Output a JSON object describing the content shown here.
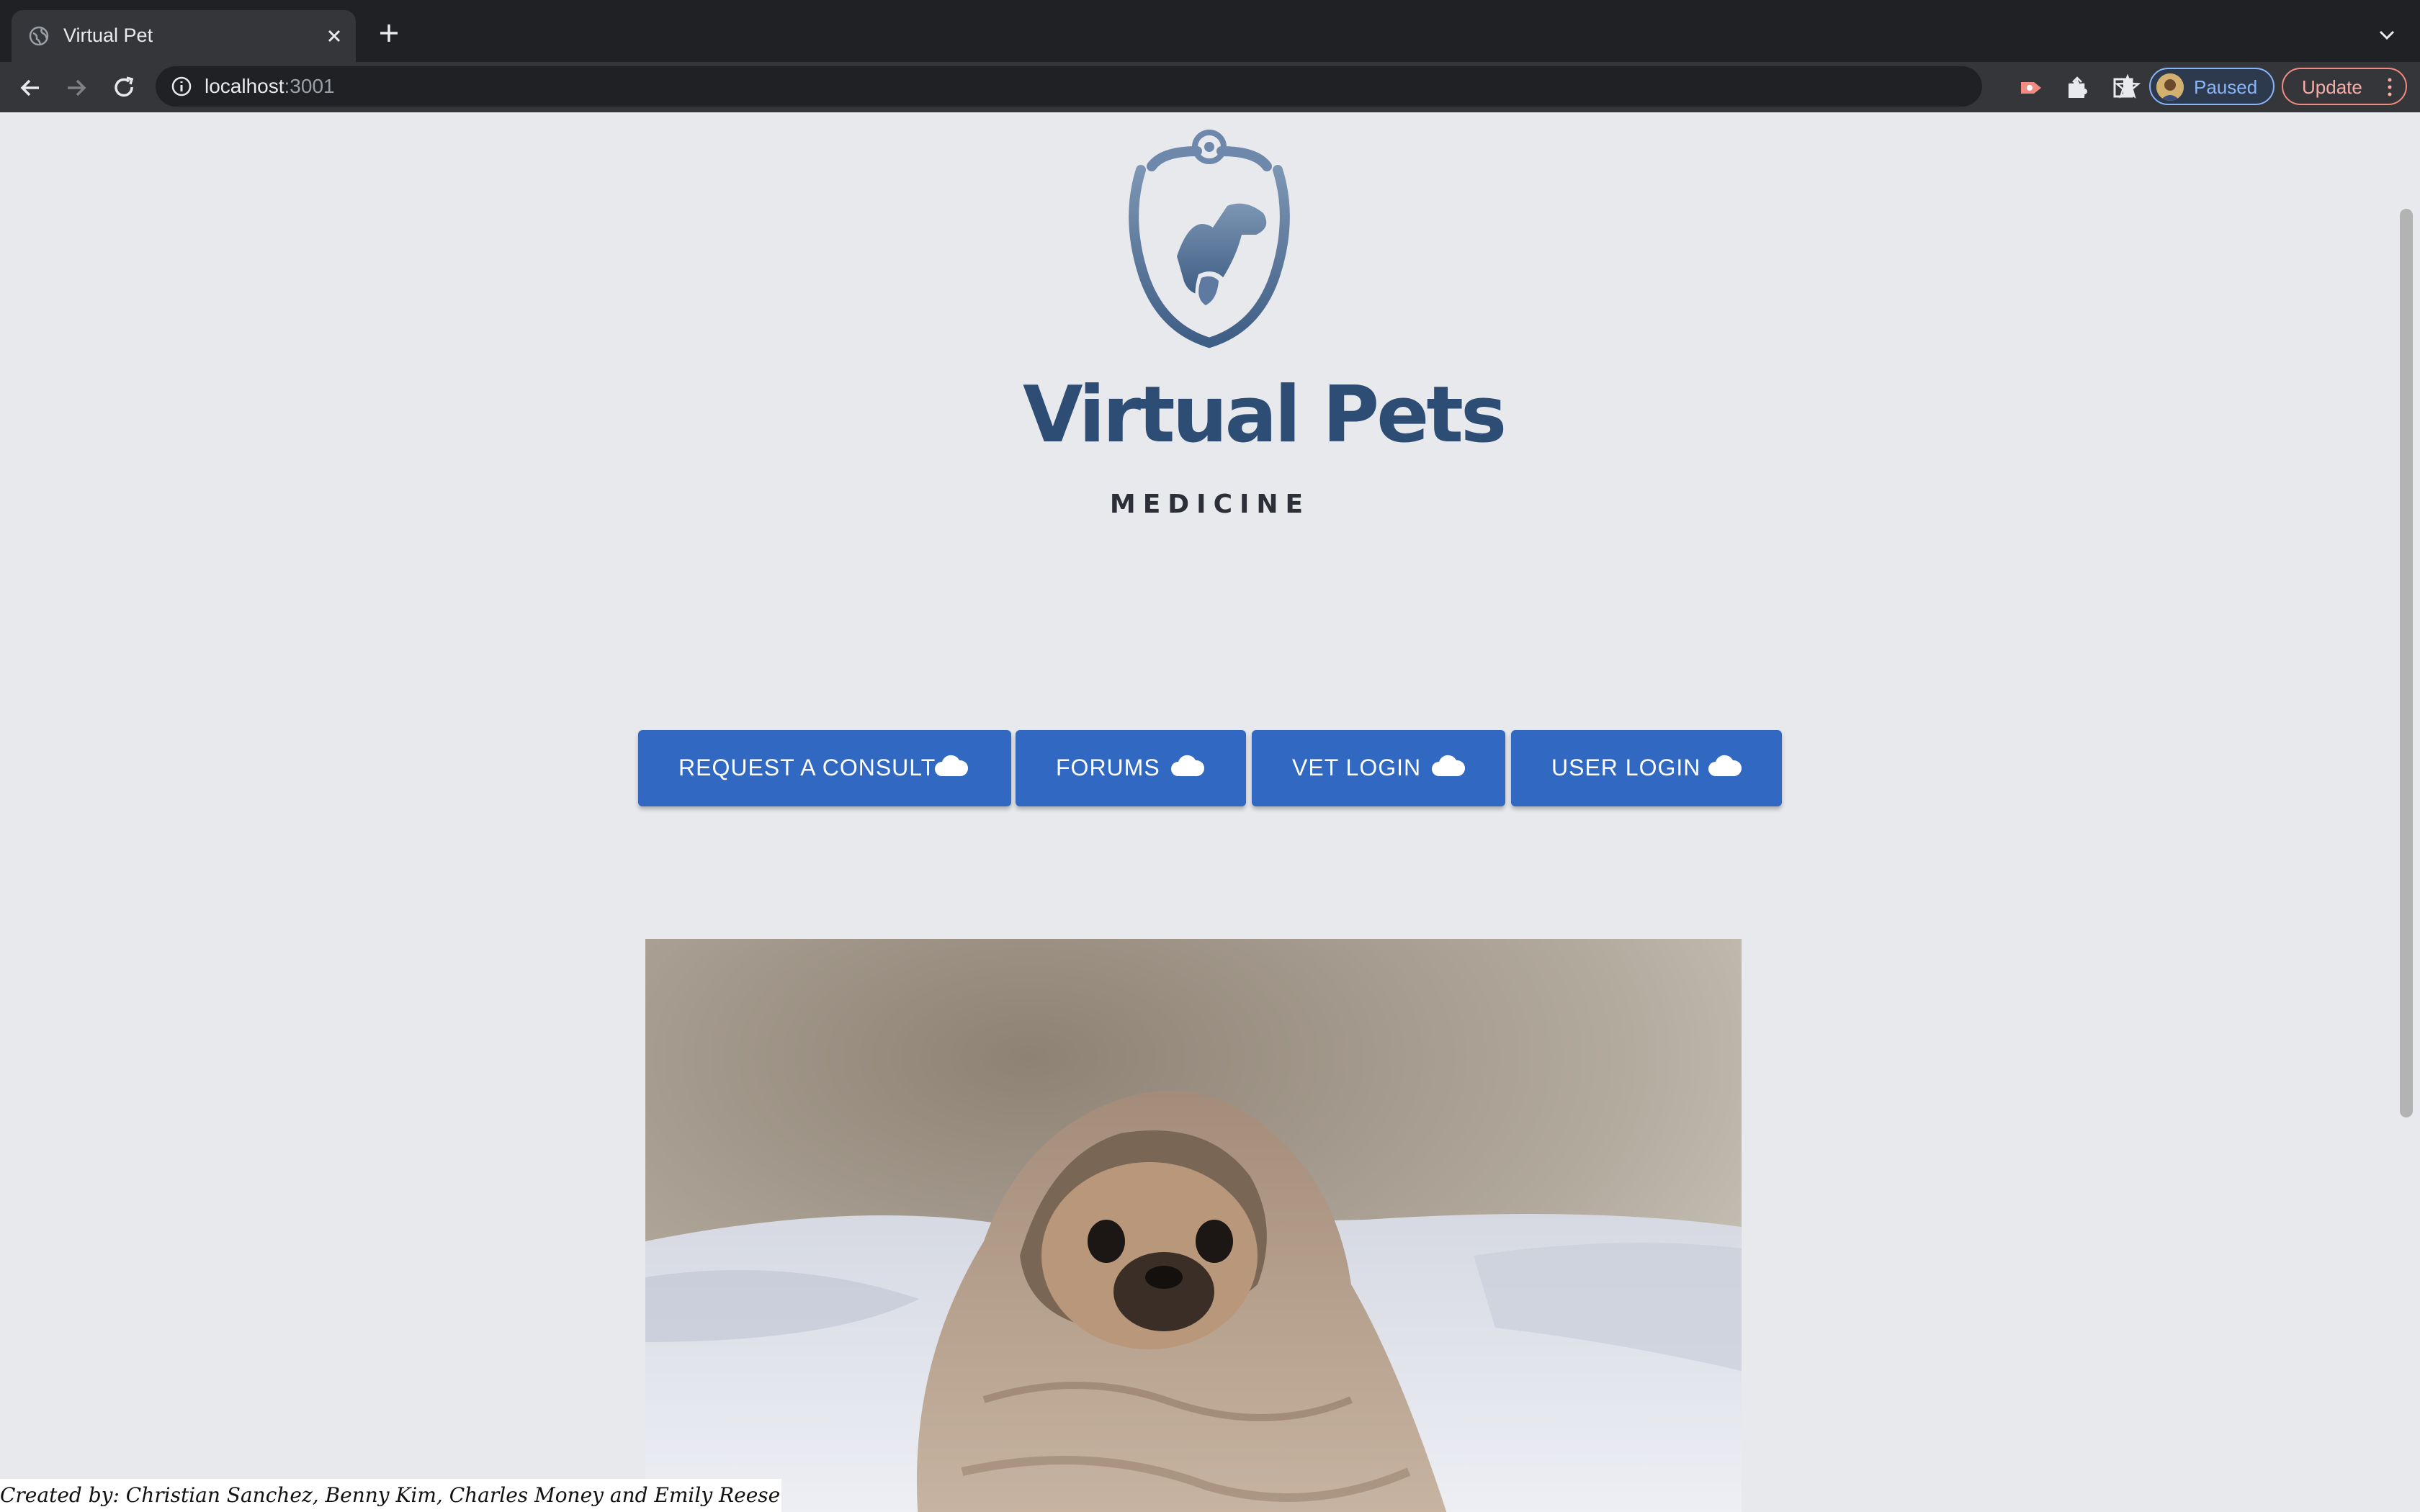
{
  "browser": {
    "tab_title": "Virtual Pet",
    "url_host": "localhost",
    "url_port": ":3001",
    "profile_status": "Paused",
    "update_label": "Update"
  },
  "logo": {
    "title": "Virtual Pets",
    "subtitle": "MEDICINE"
  },
  "nav": {
    "buttons": [
      {
        "label": "REQUEST A CONSULT",
        "icon": "cloud-icon"
      },
      {
        "label": "FORUMS",
        "icon": "cloud-icon"
      },
      {
        "label": "VET LOGIN",
        "icon": "cloud-icon"
      },
      {
        "label": "USER LOGIN",
        "icon": "cloud-icon"
      }
    ]
  },
  "hero": {
    "image": "pug-in-blanket-photo"
  },
  "footer": {
    "credit": "Created by: Christian Sanchez, Benny Kim, Charles Money and Emily Reese"
  },
  "colors": {
    "page_bg": "#e8e9ed",
    "button_bg": "#3068c2",
    "logo_blue": "#2d4d74"
  }
}
